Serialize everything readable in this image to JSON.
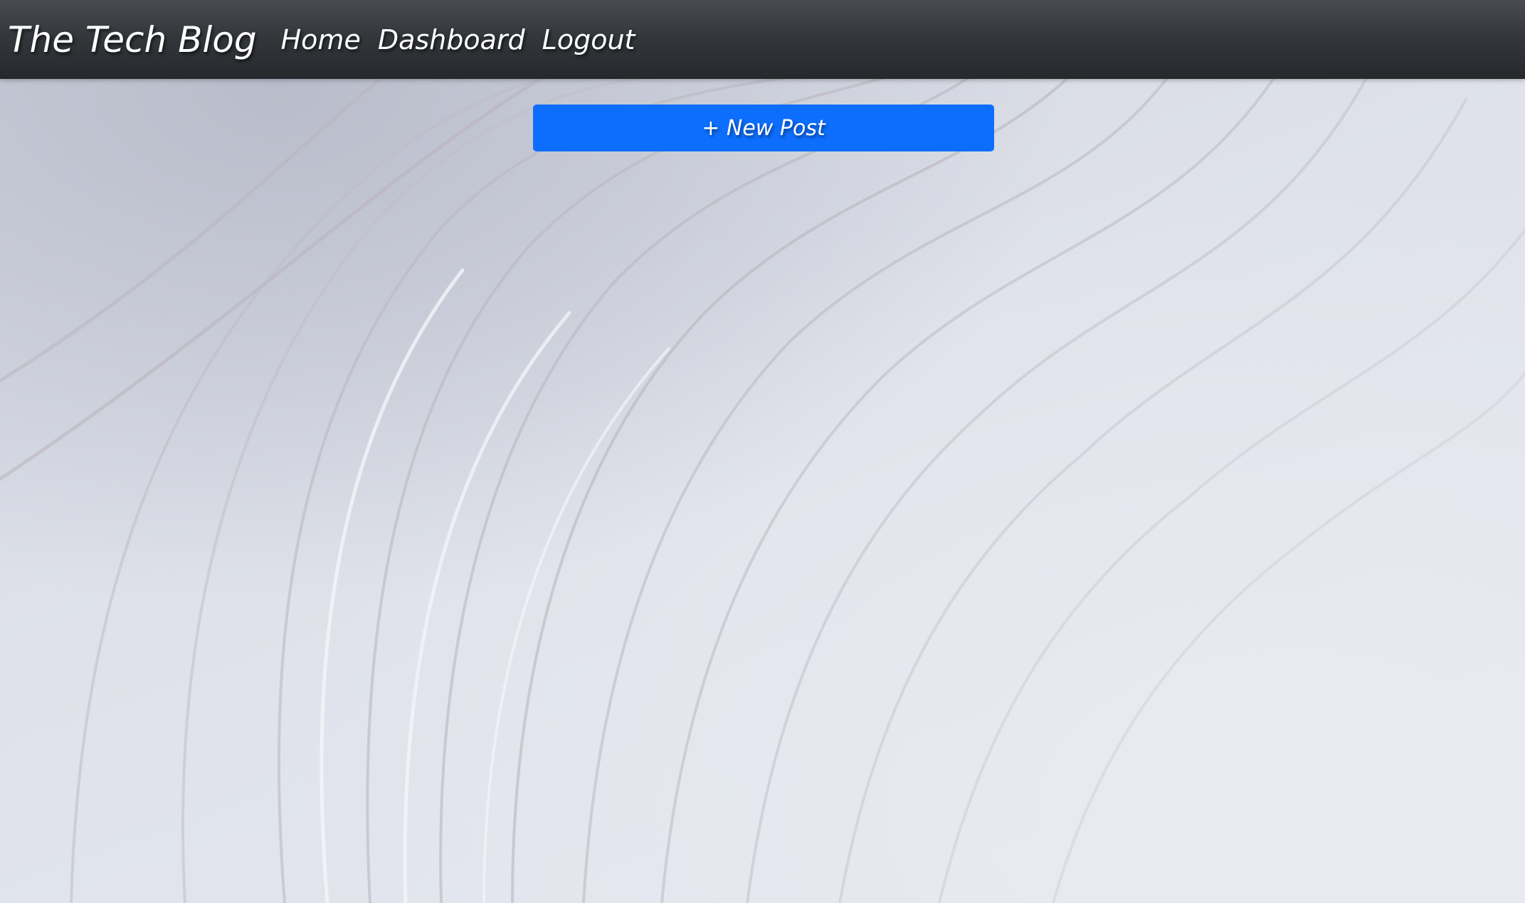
{
  "navbar": {
    "brand": "The Tech Blog",
    "links": [
      {
        "label": "Home"
      },
      {
        "label": "Dashboard"
      },
      {
        "label": "Logout"
      }
    ]
  },
  "main": {
    "new_post_label": "+ New Post"
  },
  "colors": {
    "navbar_top": "#484b51",
    "navbar_bottom": "#26282c",
    "button_primary": "#0d6efd",
    "background": "#dde1ea"
  }
}
